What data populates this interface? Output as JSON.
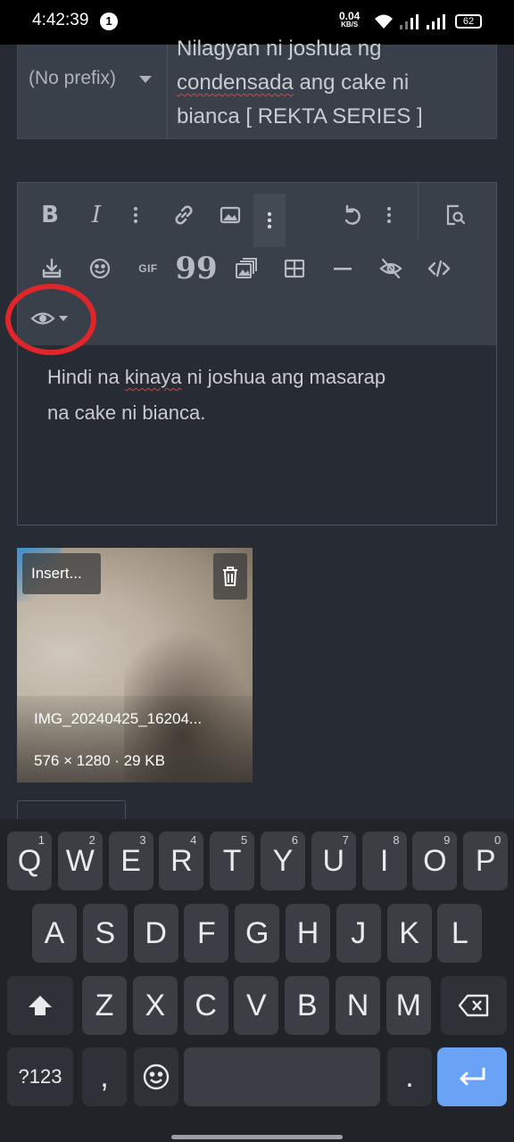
{
  "status_bar": {
    "time": "4:42:39",
    "notification_count": "1",
    "speed_value": "0.04",
    "speed_unit": "KB/S",
    "battery": "62"
  },
  "thread": {
    "prefix_label": "(No prefix)",
    "title_line1": "Nilagyan ni joshua ng",
    "title_line2": "condensada",
    "title_line2_rest": " ang cake ni",
    "title_line3": "bianca [ REKTA SERIES ]"
  },
  "editor": {
    "toolbar_row1": [
      "bold-icon",
      "italic-icon",
      "more-vertical-icon",
      "link-icon",
      "image-icon",
      "more-vertical-icon",
      "undo-icon",
      "more-vertical-icon",
      "preview-icon"
    ],
    "toolbar_row2": [
      "insert-icon",
      "emoji-icon",
      "gif-icon",
      "quote-icon",
      "media-icon",
      "table-icon",
      "horizontal-rule-icon",
      "hide-icon",
      "code-icon"
    ],
    "gif_label": "GIF",
    "quote_glyph": "99",
    "body_line1_a": "Hindi na ",
    "body_line1_b": "kinaya",
    "body_line1_c": " ni joshua ang masarap",
    "body_line2": "na cake ni bianca.",
    "annotation_color": "#e0252b"
  },
  "attachment": {
    "insert_label": "Insert...",
    "filename": "IMG_20240425_16204...",
    "info": "576 × 1280 · 29 KB"
  },
  "keyboard": {
    "row1": [
      {
        "k": "Q",
        "n": "1"
      },
      {
        "k": "W",
        "n": "2"
      },
      {
        "k": "E",
        "n": "3"
      },
      {
        "k": "R",
        "n": "4"
      },
      {
        "k": "T",
        "n": "5"
      },
      {
        "k": "Y",
        "n": "6"
      },
      {
        "k": "U",
        "n": "7"
      },
      {
        "k": "I",
        "n": "8"
      },
      {
        "k": "O",
        "n": "9"
      },
      {
        "k": "P",
        "n": "0"
      }
    ],
    "row2": [
      "A",
      "S",
      "D",
      "F",
      "G",
      "H",
      "J",
      "K",
      "L"
    ],
    "row3": [
      "Z",
      "X",
      "C",
      "V",
      "B",
      "N",
      "M"
    ],
    "symbols_label": "?123",
    "comma": ",",
    "period": "."
  }
}
